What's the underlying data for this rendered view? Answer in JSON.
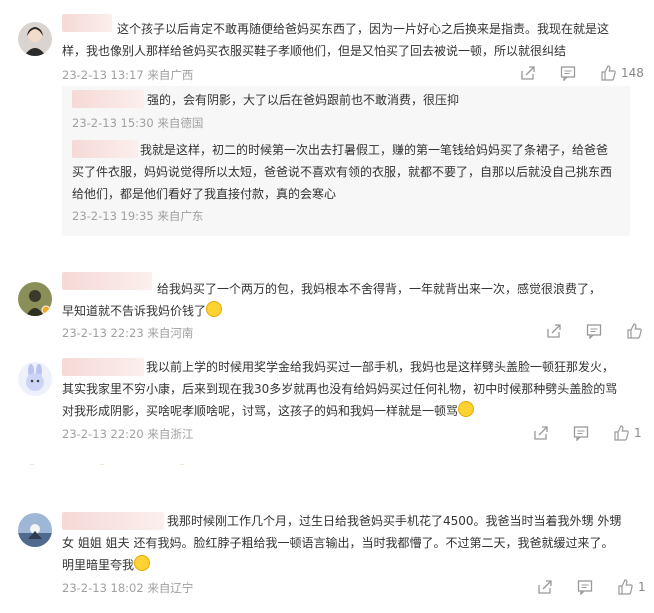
{
  "comments": [
    {
      "text_lines": [
        "这个孩子以后肯定不敢再随便给爸妈买东西了，因为一片好心之后换来是指责。我现在就是这",
        "样，我也像别人那样给爸妈买衣服买鞋子孝顺他们，但是又怕买了回去被说一顿，所以就很纠结"
      ],
      "meta": "23-2-13 13:17 来自广西",
      "likes": "148",
      "replies": [
        {
          "text_lines": [
            "强的，会有阴影，大了以后在爸妈跟前也不敢消费，很压抑"
          ],
          "meta": "23-2-13 15:30 来自德国"
        },
        {
          "text_lines": [
            "我就是这样，初二的时候第一次出去打暑假工，赚的第一笔钱给妈妈买了条裙子，给爸爸",
            "买了件衣服，妈妈说觉得所以太短，爸爸说不喜欢有领的衣服，就都不要了，自那以后就没自己挑东西",
            "给他们，都是他们看好了我直接付款，真的会寒心"
          ],
          "meta": "23-2-13 19:35 来自广东"
        }
      ]
    },
    {
      "text_lines": [
        "给我妈买了一个两万的包，我妈根本不舍得背，一年就背出来一次，感觉很浪费了，",
        "早知道就不告诉我妈价钱了"
      ],
      "meta": "23-2-13 22:23 来自河南",
      "likes": ""
    },
    {
      "text_lines": [
        "我以前上学的时候用奖学金给我妈买过一部手机，我妈也是这样劈头盖脸一顿狂那发火，",
        "其实我家里不穷小康，后来到现在我30多岁就再也没有给妈妈买过任何礼物，初中时候那种劈头盖脸的骂",
        "对我形成阴影，买啥呢孝顺啥呢，讨骂，这孩子的妈和我妈一样就是一顿骂"
      ],
      "meta": "23-2-13 22:20 来自浙江",
      "likes": "1"
    },
    {
      "text_lines": [
        "我那时候刚工作几个月，过生日给我爸妈买手机花了4500。我爸当时当着我外甥 外甥",
        "女 姐姐 姐夫 还有我妈。脸红脖子粗给我一顿语言输出，当时我都懵了。不过第二天，我爸就缓过来了。",
        "明里暗里夸我"
      ],
      "meta": "23-2-13 18:02 来自辽宁",
      "likes": "1"
    }
  ],
  "icons": [
    "share-icon",
    "comment-icon",
    "like-icon"
  ],
  "colors": {
    "meta": "#a0a0a0",
    "text": "#333333",
    "reply_bg": "#f7f7f7",
    "blur": "#f5d9d6"
  }
}
